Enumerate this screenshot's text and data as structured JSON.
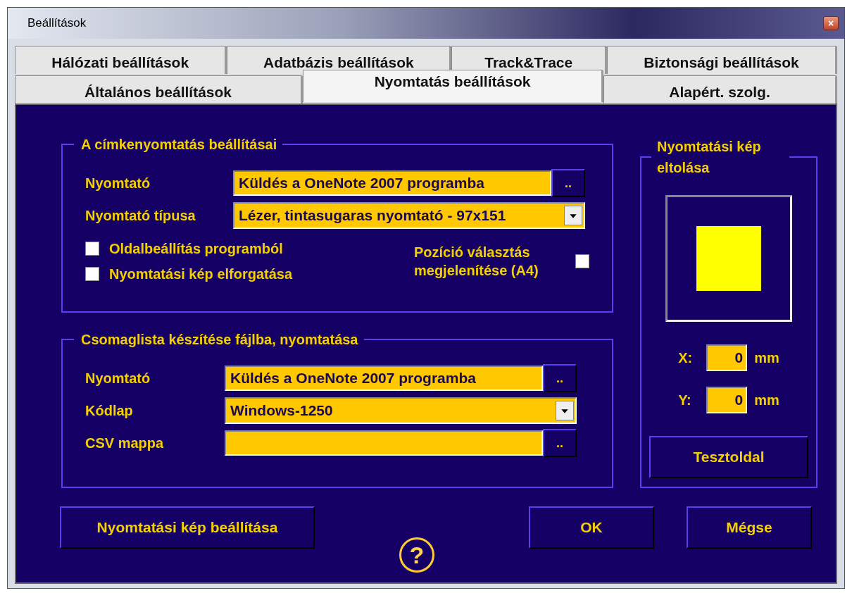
{
  "window": {
    "title": "Beállítások",
    "close": "×"
  },
  "tab_rows": [
    {
      "tabs": [
        {
          "label": "Hálózati beállítások",
          "selected": false
        },
        {
          "label": "Adatbázis beállítások",
          "selected": false
        },
        {
          "label": "Track&Trace",
          "selected": false
        },
        {
          "label": "Biztonsági beállítások",
          "selected": false
        }
      ]
    },
    {
      "tabs": [
        {
          "label": "Általános beállítások",
          "selected": false
        },
        {
          "label": "Nyomtatás beállítások",
          "selected": true
        },
        {
          "label": "Alapért. szolg.",
          "selected": false
        }
      ]
    }
  ],
  "label_group": {
    "title": "A címkenyomtatás beállításai",
    "fields": [
      {
        "kind": "browse",
        "label": "Nyomtató",
        "value": "Küldés a OneNote 2007 programba",
        "button": ".."
      },
      {
        "kind": "dropdown",
        "label": "Nyomtató típusa",
        "value": "Lézer, tintasugaras nyomtató - 97x151"
      }
    ],
    "checkboxes": [
      {
        "label": "Oldalbeállítás programból",
        "checked": false
      },
      {
        "label": "Nyomtatási kép elforgatása",
        "checked": false
      }
    ],
    "position_checkbox": {
      "label": "Pozíció választás megjelenítése (A4)",
      "checked": false
    }
  },
  "package_group": {
    "title": "Csomaglista készítése fájlba, nyomtatása",
    "fields": [
      {
        "kind": "browse",
        "label": "Nyomtató",
        "value": "Küldés a OneNote 2007 programba",
        "button": ".."
      },
      {
        "kind": "dropdown",
        "label": "Kódlap",
        "value": "Windows-1250"
      },
      {
        "kind": "browse",
        "label": "CSV mappa",
        "button": ".."
      }
    ]
  },
  "offset_group": {
    "title": "Nyomtatási kép eltolása",
    "coords": [
      {
        "label": "X:",
        "value": "0",
        "unit": "mm"
      },
      {
        "label": "Y:",
        "value": "0",
        "unit": "mm"
      }
    ],
    "test_button": "Tesztoldal"
  },
  "buttons": {
    "setup": "Nyomtatási kép beállítása",
    "help": "?",
    "ok": "OK",
    "cancel": "Mégse"
  }
}
